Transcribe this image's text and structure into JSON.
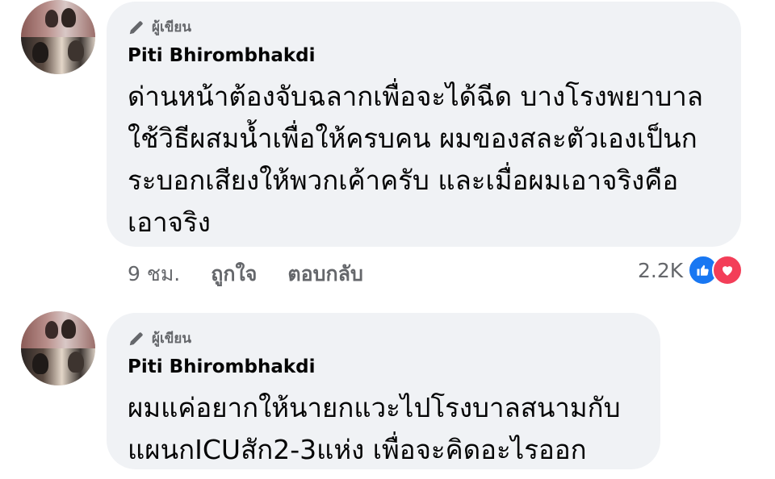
{
  "comments": [
    {
      "author_badge": "ผู้เขียน",
      "author_name": "Piti Bhirombhakdi",
      "text": "ด่านหน้าต้องจับฉลากเพื่อจะได้ฉีด บางโรงพยาบาล ใช้วิธีผสมน้ำเพื่อให้ครบคน ผมของสละตัวเองเป็นก ระบอกเสียงให้พวกเค้าครับ และเมื่อผมเอาจริงคือ เอาจริง",
      "lines": [
        "ด่านหน้าต้องจับฉลากเพื่อจะได้ฉีด บางโรงพยาบาล",
        "ใช้วิธีผสมน้ำเพื่อให้ครบคน ผมของสละตัวเองเป็นก",
        "ระบอกเสียงให้พวกเค้าครับ และเมื่อผมเอาจริงคือ",
        "เอาจริง"
      ],
      "time": "9 ชม.",
      "like_action": "ถูกใจ",
      "reply_action": "ตอบกลับ",
      "reaction_count": "2.2K",
      "reaction_icons": [
        "like-icon",
        "love-icon"
      ]
    },
    {
      "author_badge": "ผู้เขียน",
      "author_name": "Piti Bhirombhakdi",
      "lines": [
        "ผมแค่อยากให้นายกแวะไปโรงบาลสนามกับ",
        "แผนกICUสัก2-3แห่ง เพื่อจะคิดอะไรออก"
      ]
    }
  ],
  "colors": {
    "bubble": "#f0f2f5",
    "meta_text": "#65676b",
    "like": "#1877f2",
    "love": "#f33e58"
  }
}
